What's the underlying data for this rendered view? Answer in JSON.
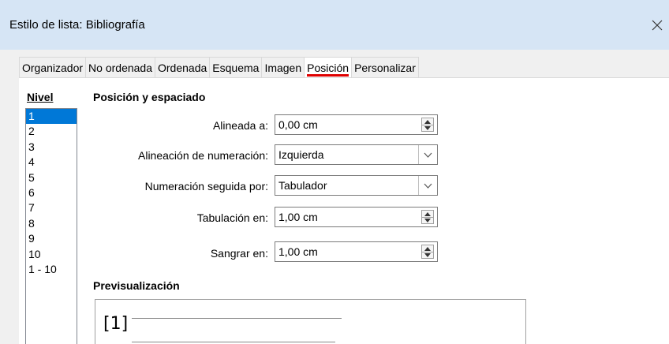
{
  "window": {
    "title": "Estilo de lista: Bibliografía"
  },
  "tabs": [
    {
      "label": "Organizador"
    },
    {
      "label": "No ordenada"
    },
    {
      "label": "Ordenada"
    },
    {
      "label": "Esquema"
    },
    {
      "label": "Imagen"
    },
    {
      "label": "Posición"
    },
    {
      "label": "Personalizar"
    }
  ],
  "active_tab": "Posición",
  "level": {
    "label": "Nivel",
    "items": [
      "1",
      "2",
      "3",
      "4",
      "5",
      "6",
      "7",
      "8",
      "9",
      "10",
      "1 - 10"
    ],
    "selected": "1"
  },
  "position": {
    "section_title": "Posición y espaciado",
    "aligned_at": {
      "label": "Alineada a:",
      "value": "0,00 cm"
    },
    "numbering_alignment": {
      "label": "Alineación de numeración:",
      "value": "Izquierda"
    },
    "numbering_followed_by": {
      "label": "Numeración seguida por:",
      "value": "Tabulador"
    },
    "tab_stop_at": {
      "label": "Tabulación en:",
      "value": "1,00 cm"
    },
    "indent_at": {
      "label": "Sangrar en:",
      "value": "1,00 cm"
    }
  },
  "preview": {
    "title": "Previsualización",
    "sample_number": "[1]"
  },
  "colors": {
    "titlebar": "#d6e5f5",
    "selection": "#0078d7",
    "active_tab_underline": "#e00000"
  }
}
